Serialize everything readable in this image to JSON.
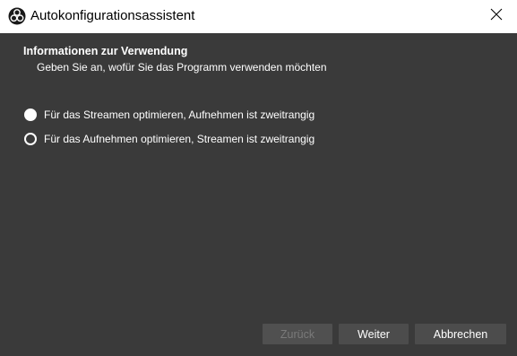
{
  "window": {
    "title": "Autokonfigurationsassistent"
  },
  "titlebar": {
    "app_icon": "obs-logo-icon",
    "close_icon": "close-icon"
  },
  "header": {
    "title": "Informationen zur Verwendung",
    "subtitle": "Geben Sie an, wofür Sie das Programm verwenden möchten"
  },
  "usage_options": [
    {
      "label": "Für das Streamen optimieren, Aufnehmen ist zweitrangig",
      "selected": true
    },
    {
      "label": "Für das Aufnehmen optimieren, Streamen ist zweitrangig",
      "selected": false
    }
  ],
  "buttons": {
    "back": {
      "label": "Zurück",
      "enabled": false
    },
    "next": {
      "label": "Weiter",
      "enabled": true
    },
    "cancel": {
      "label": "Abbrechen",
      "enabled": true
    }
  },
  "colors": {
    "background": "#3a3a3a",
    "titlebar": "#ffffff",
    "button": "#4c4c4c",
    "button_disabled_text": "#7a7a7a",
    "text": "#ffffff"
  }
}
